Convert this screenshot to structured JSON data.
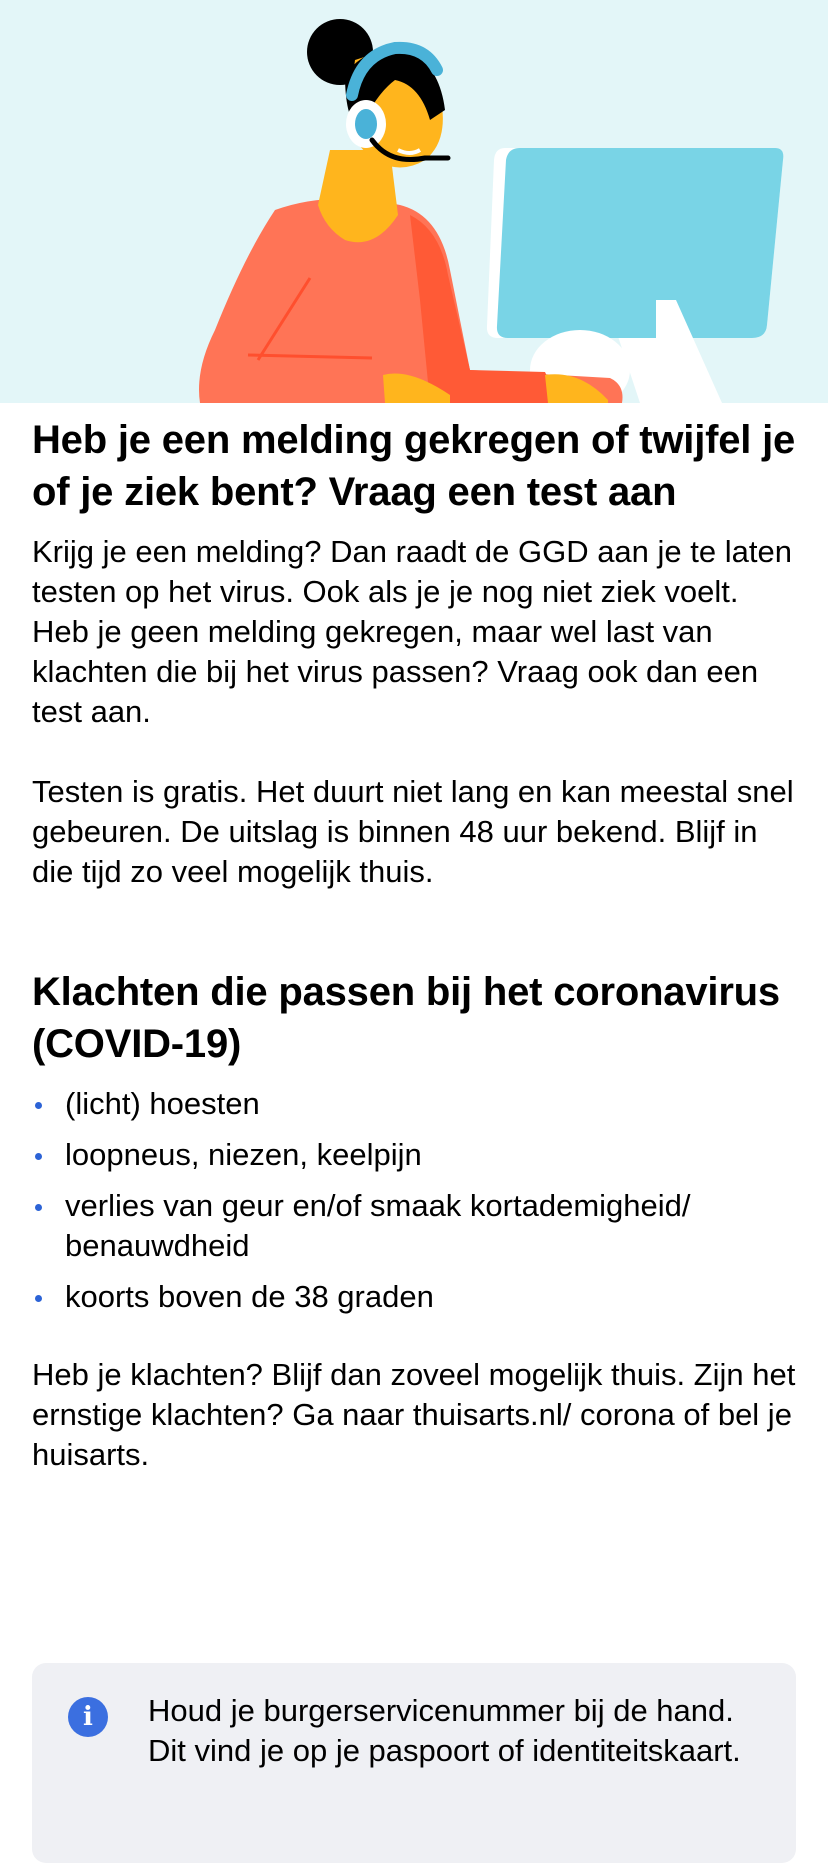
{
  "hero": {
    "illustration": "support-agent-with-headset-and-monitor-illustration",
    "colors": {
      "background": "#e3f6f8",
      "hair": "#000000",
      "skin": "#ffb51d",
      "shirt": "#ff7456",
      "shirt_shadow": "#ff5a36",
      "headset": "#4ab2d8",
      "monitor": "#79d4e6"
    }
  },
  "main": {
    "title": "Heb je een melding gekregen of twijfel je of je ziek bent? Vraag een test aan",
    "paragraph1": "Krijg je een melding? Dan raadt de GGD aan je te laten testen op het virus. Ook als je je nog niet ziek voelt. Heb je geen melding gekregen, maar wel last van klachten die bij het virus passen? Vraag ook dan een test aan.",
    "paragraph2": "Testen is gratis. Het duurt niet lang en kan meestal snel gebeuren. De uitslag is binnen 48 uur bekend. Blijf in die tijd zo veel mogelijk thuis."
  },
  "symptoms": {
    "heading": "Klachten die passen bij het coronavirus (COVID-19)",
    "items": [
      "(licht) hoesten",
      "loopneus, niezen, keelpijn",
      "verlies van geur en/of smaak kortademigheid/ benauwdheid",
      "koorts boven de 38 graden"
    ],
    "bullet_color": "#2c63d6"
  },
  "advice": {
    "text": "Heb je klachten? Blijf dan zoveel mogelijk thuis. Zijn het ernstige klachten? Ga naar thuisarts.nl/ corona of bel je huisarts."
  },
  "info": {
    "icon": "info-icon",
    "icon_glyph": "i",
    "text": "Houd je burgerservicenummer bij de hand. Dit vind je op je paspoort of identiteitskaart.",
    "colors": {
      "background": "#eff0f4",
      "icon": "#3b6fe0"
    }
  }
}
